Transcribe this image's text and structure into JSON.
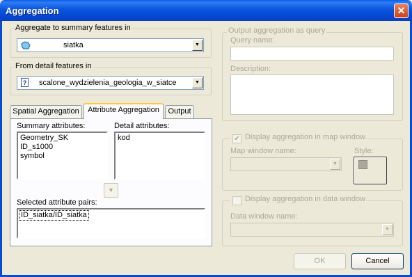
{
  "window": {
    "title": "Aggregation",
    "close_glyph": "✕"
  },
  "summary_group": {
    "legend": "Aggregate to summary features in",
    "selected": "siatka",
    "icon": "polygon-layer-icon"
  },
  "detail_group": {
    "legend": "From detail features in",
    "selected": "scalone_wydzielenia_geologia_w_siatce",
    "icon_glyph": "?"
  },
  "tabs": [
    {
      "label": "Spatial Aggregation"
    },
    {
      "label": "Attribute Aggregation"
    },
    {
      "label": "Output"
    }
  ],
  "attribute_tab": {
    "summary_label": "Summary attributes:",
    "summary_items": [
      "Geometry_SK",
      "ID_s1000",
      "symbol"
    ],
    "detail_label": "Detail attributes:",
    "detail_items": [
      "kod"
    ],
    "pairs_label": "Selected attribute pairs:",
    "pairs_items": [
      "ID_siatka/ID_siatka"
    ]
  },
  "query_group": {
    "legend": "Output aggregation as query",
    "name_label": "Query name:",
    "description_label": "Description:"
  },
  "map_group": {
    "checkbox_label": "Display aggregation in map window",
    "checked": true,
    "map_name_label": "Map window name:",
    "style_label": "Style:"
  },
  "data_group": {
    "checkbox_label": "Display aggregation in data window",
    "checked": false,
    "data_name_label": "Data window name:"
  },
  "buttons": {
    "ok": "OK",
    "cancel": "Cancel"
  },
  "colors": {
    "titlebar": "#0a55df",
    "face": "#ece9d8",
    "disabled_text": "#aca899",
    "active_tab_accent": "#ffc83c"
  }
}
